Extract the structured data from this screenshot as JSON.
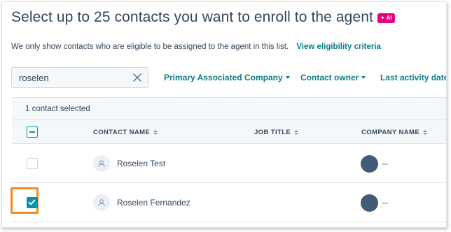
{
  "header": {
    "title": "Select up to 25 contacts you want to enroll to the agent",
    "ai_badge": "✦ AI"
  },
  "info": {
    "text": "We only show contacts who are eligible to be assigned to the agent in this list.",
    "link": "View eligibility criteria"
  },
  "search": {
    "value": "roselen",
    "icon": "close-icon"
  },
  "filters": [
    {
      "label": "Primary Associated Company"
    },
    {
      "label": "Contact owner"
    },
    {
      "label": "Last activity date"
    }
  ],
  "table": {
    "selected_text": "1 contact selected",
    "columns": [
      "CONTACT NAME",
      "JOB TITLE",
      "COMPANY NAME"
    ],
    "rows": [
      {
        "name": "Roselen Test",
        "company": "--",
        "checked": false
      },
      {
        "name": "Roselen Fernandez",
        "company": "--",
        "checked": true
      }
    ]
  },
  "colors": {
    "accent": "#0091ae",
    "link": "#0b7e8a",
    "ai_badge": "#e6007e",
    "highlight": "#f08c19",
    "text": "#33475b"
  }
}
